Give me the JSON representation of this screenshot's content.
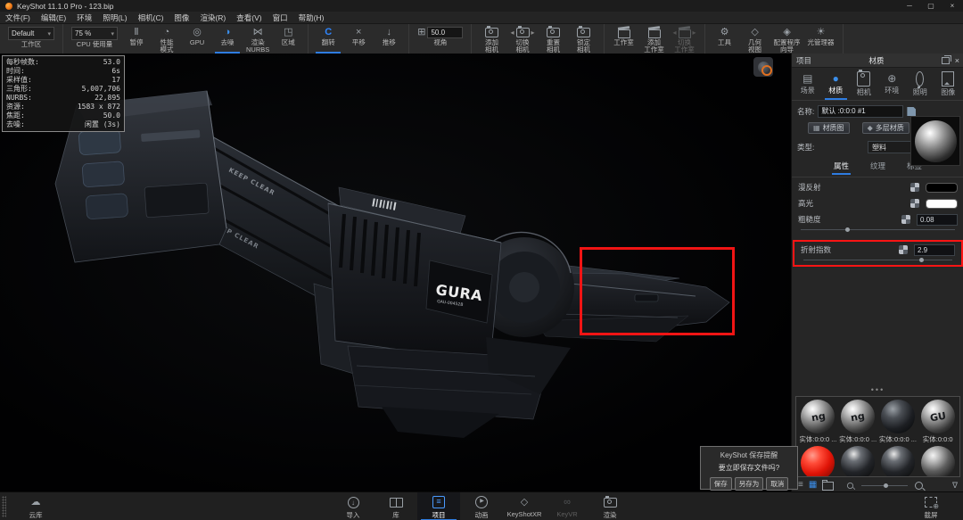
{
  "window": {
    "title": "KeyShot 11.1.0 Pro  - 123.bip"
  },
  "menu": {
    "items": [
      {
        "key": "file",
        "label": "文件(F)"
      },
      {
        "key": "edit",
        "label": "编辑(E)"
      },
      {
        "key": "environment",
        "label": "环境"
      },
      {
        "key": "lighting",
        "label": "照明(L)"
      },
      {
        "key": "camera",
        "label": "相机(C)"
      },
      {
        "key": "image",
        "label": "图像"
      },
      {
        "key": "render",
        "label": "渲染(R)"
      },
      {
        "key": "view",
        "label": "查看(V)"
      },
      {
        "key": "window",
        "label": "窗口"
      },
      {
        "key": "help",
        "label": "帮助(H)"
      }
    ]
  },
  "toolbar": {
    "groups": [
      {
        "items": [
          {
            "type": "dropdown",
            "key": "workspace",
            "value": "Default",
            "label": "工作区"
          }
        ]
      },
      {
        "items": [
          {
            "type": "dropdown",
            "key": "cpu-usage",
            "value": "75 %",
            "label": "CPU 使用量"
          },
          {
            "type": "button",
            "key": "pause",
            "icon": "pause-icon",
            "label": "暂停"
          },
          {
            "type": "button",
            "key": "performance-mode",
            "icon": "performance-icon",
            "label": "性能\n模式"
          },
          {
            "type": "button",
            "key": "gpu",
            "icon": "gpu-icon",
            "label": "GPU"
          },
          {
            "type": "button",
            "key": "denoise",
            "icon": "denoise-icon",
            "label": "去噪",
            "active": true
          },
          {
            "type": "button",
            "key": "render-nurbs",
            "icon": "nurbs-icon",
            "label": "渲染\nNURBS"
          },
          {
            "type": "button",
            "key": "region",
            "icon": "region-icon",
            "label": "区域"
          }
        ]
      },
      {
        "items": [
          {
            "type": "button",
            "key": "tumble",
            "icon": "tumble-icon",
            "label": "翻转",
            "active": true
          },
          {
            "type": "button",
            "key": "pan",
            "icon": "pan-icon",
            "label": "平移"
          },
          {
            "type": "button",
            "key": "dolly",
            "icon": "dolly-icon",
            "label": "推移"
          }
        ]
      },
      {
        "items": [
          {
            "type": "field",
            "key": "fov",
            "icon": "fov-icon",
            "value": "50.0",
            "label": "视角"
          }
        ]
      },
      {
        "items": [
          {
            "type": "button",
            "key": "add-camera",
            "icon": "add-camera-icon",
            "label": "添加\n相机"
          },
          {
            "type": "button",
            "key": "switch-camera",
            "icon": "switch-camera-icon",
            "label": "切换\n相机",
            "arrows": true
          },
          {
            "type": "button",
            "key": "reset-camera",
            "icon": "reset-camera-icon",
            "label": "重置\n相机"
          },
          {
            "type": "button",
            "key": "lock-camera",
            "icon": "lock-camera-icon",
            "label": "锁定\n相机"
          }
        ]
      },
      {
        "items": [
          {
            "type": "button",
            "key": "studio",
            "icon": "studio-icon",
            "label": "工作室"
          },
          {
            "type": "button",
            "key": "add-studio",
            "icon": "add-studio-icon",
            "label": "添加\n工作室"
          },
          {
            "type": "button",
            "key": "switch-studio",
            "icon": "switch-studio-icon",
            "label": "切换\n工作室",
            "arrows": true,
            "disabled": true
          }
        ]
      },
      {
        "items": [
          {
            "type": "button",
            "key": "tools",
            "icon": "tools-icon",
            "label": "工具"
          },
          {
            "type": "button",
            "key": "geometry-view",
            "icon": "geometry-view-icon",
            "label": "几何\n视图"
          },
          {
            "type": "button",
            "key": "configurator-wizard",
            "icon": "configurator-icon",
            "label": "配置程序\n向导"
          },
          {
            "type": "button",
            "key": "light-manager",
            "icon": "light-manager-icon",
            "label": "光管理器"
          }
        ]
      }
    ]
  },
  "viewport": {
    "stats": [
      {
        "key": "fps",
        "label": "每秒帧数:",
        "value": "53.0"
      },
      {
        "key": "time",
        "label": "时间:",
        "value": "6s"
      },
      {
        "key": "samples",
        "label": "采样值:",
        "value": "17"
      },
      {
        "key": "triangles",
        "label": "三角形:",
        "value": "5,007,706"
      },
      {
        "key": "nurbs",
        "label": "NURBS:",
        "value": "22,895"
      },
      {
        "key": "resolution",
        "label": "资源:",
        "value": "1583 x 872"
      },
      {
        "key": "focal",
        "label": "焦距:",
        "value": "50.0"
      },
      {
        "key": "denoise",
        "label": "去噪:",
        "value": "闲置 (3s)"
      }
    ],
    "model": {
      "brand": "GURA",
      "code": "GAU-00452B",
      "warning": "KEEP CLEAR"
    }
  },
  "panel": {
    "header": {
      "project_tab": "项目",
      "title": "材质"
    },
    "tabs": [
      {
        "key": "scene",
        "label": "场景",
        "icon": "scene-icon"
      },
      {
        "key": "material",
        "label": "材质",
        "icon": "material-icon",
        "active": true
      },
      {
        "key": "camera",
        "label": "相机",
        "icon": "camera-icon"
      },
      {
        "key": "environment",
        "label": "环境",
        "icon": "environment-icon"
      },
      {
        "key": "lighting",
        "label": "照明",
        "icon": "lighting-icon"
      },
      {
        "key": "image",
        "label": "图像",
        "icon": "image-icon"
      }
    ],
    "name": {
      "label": "名称:",
      "value": "默认 :0:0:0  #1"
    },
    "actions": {
      "material_graph": "材质图",
      "multi_material": "多层材质"
    },
    "type": {
      "label": "类型:",
      "value": "塑料"
    },
    "subtabs": [
      {
        "key": "properties",
        "label": "属性",
        "active": true
      },
      {
        "key": "textures",
        "label": "纹理"
      },
      {
        "key": "labels",
        "label": "标签"
      }
    ],
    "properties": {
      "diffuse": {
        "label": "漫反射",
        "swatch": "#000000"
      },
      "specular": {
        "label": "高光",
        "swatch": "#ffffff"
      },
      "roughness": {
        "label": "粗糙度",
        "value": "0.08"
      },
      "refraction": {
        "label": "折射指数",
        "value": "2.9",
        "highlighted": true
      }
    },
    "library": {
      "rows": [
        [
          {
            "style": "silver",
            "mark": "ng",
            "label": "实体:0:0:0 ..."
          },
          {
            "style": "silver",
            "mark": "ng",
            "label": "实体:0:0:0 ..."
          },
          {
            "style": "dark",
            "mark": "",
            "label": "实体:0:0:0 ..."
          },
          {
            "style": "silver",
            "mark": "GU",
            "label": "实体:0:0:0"
          }
        ],
        [
          {
            "style": "red",
            "mark": ""
          },
          {
            "style": "dark2",
            "mark": ""
          },
          {
            "style": "dark2",
            "mark": ""
          },
          {
            "style": "silver2",
            "mark": ""
          }
        ]
      ]
    }
  },
  "dialog": {
    "title": "KeyShot  保存提醒",
    "message": "要立即保存文件吗?",
    "buttons": [
      {
        "key": "save",
        "label": "保存"
      },
      {
        "key": "save-as",
        "label": "另存为"
      },
      {
        "key": "cancel",
        "label": "取消"
      }
    ]
  },
  "dock": {
    "left": {
      "key": "cloud-library",
      "label": "云库",
      "icon": "cloud-icon"
    },
    "items": [
      {
        "key": "import",
        "label": "导入",
        "icon": "import-icon"
      },
      {
        "key": "library",
        "label": "库",
        "icon": "library-icon"
      },
      {
        "key": "project",
        "label": "项目",
        "icon": "project-icon",
        "active": true
      },
      {
        "key": "animation",
        "label": "动画",
        "icon": "animation-icon"
      },
      {
        "key": "keyshot-xr",
        "label": "KeyShotXR",
        "icon": "xr-icon"
      },
      {
        "key": "key-vr",
        "label": "KeyVR",
        "icon": "vr-icon",
        "disabled": true
      },
      {
        "key": "render",
        "label": "渲染",
        "icon": "render-icon"
      }
    ],
    "right": {
      "key": "screenshot",
      "label": "截屏",
      "icon": "screenshot-icon"
    }
  },
  "colors": {
    "accent": "#2e7ce0",
    "highlight": "#ff1414",
    "selected_material": "#e01407"
  }
}
